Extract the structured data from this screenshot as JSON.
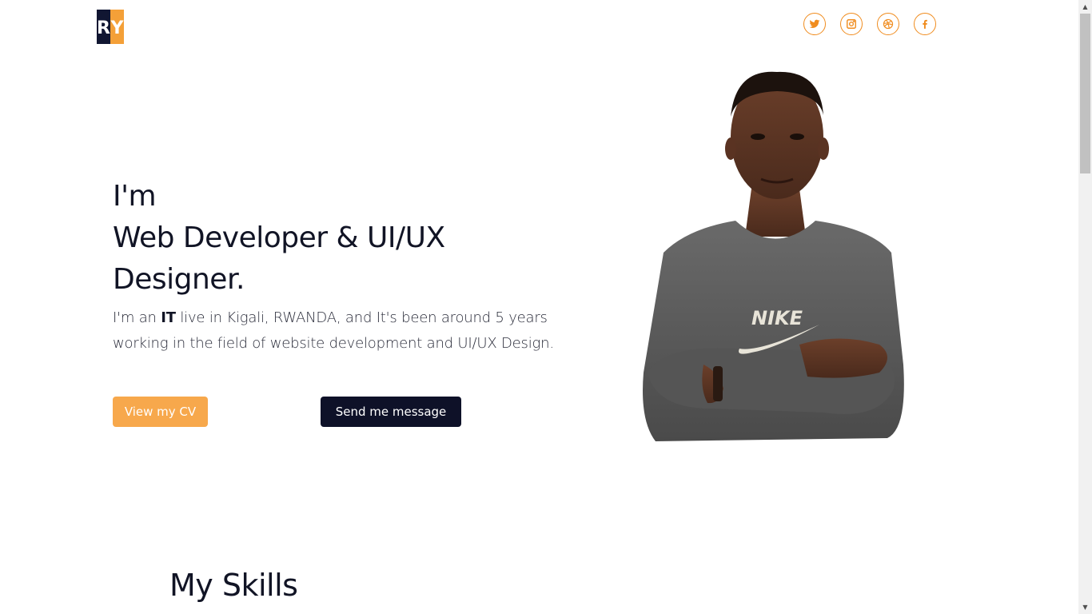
{
  "logo": {
    "letter1": "R",
    "letter2": "Y"
  },
  "socials": [
    {
      "name": "twitter-icon"
    },
    {
      "name": "instagram-icon"
    },
    {
      "name": "dribbble-icon"
    },
    {
      "name": "facebook-icon"
    }
  ],
  "hero": {
    "line1": "I'm",
    "line2": "Web Developer & UI/UX",
    "line3": "Designer.",
    "desc_pre": "I'm an ",
    "desc_bold": "IT",
    "desc_post": " live in Kigali, RWANDA, and It's been around 5 years working in the field of website development and UI/UX Design."
  },
  "buttons": {
    "cv": "View my CV",
    "message": "Send me message"
  },
  "portrait": {
    "shirt_text": "NIKE"
  },
  "skills": {
    "title": "My Skills"
  },
  "colors": {
    "accent": "#f08c1e",
    "cv_button": "#f7a84c",
    "dark": "#0e1128"
  }
}
